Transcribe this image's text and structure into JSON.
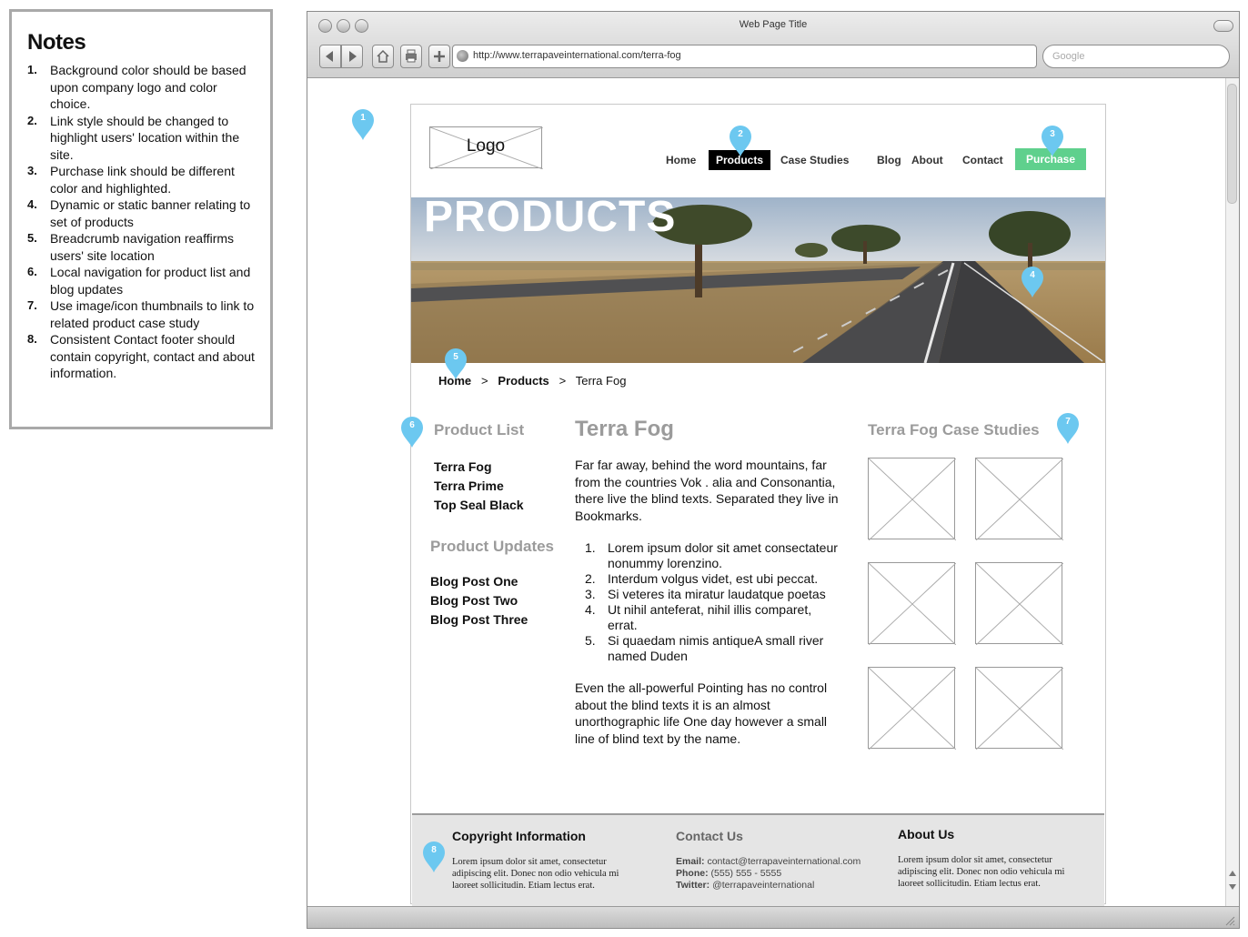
{
  "notes": {
    "title": "Notes",
    "items": [
      {
        "num": "1.",
        "text": "Background color should be based upon company logo and color choice."
      },
      {
        "num": "2.",
        "text": "Link style should be changed to highlight users' location within the site."
      },
      {
        "num": "3.",
        "text": "Purchase link should be different color and highlighted."
      },
      {
        "num": "4.",
        "text": "Dynamic or static banner relating to set of products"
      },
      {
        "num": "5.",
        "text": "Breadcrumb navigation reaffirms users' site location"
      },
      {
        "num": "6.",
        "text": "Local navigation for product list and blog updates"
      },
      {
        "num": "7.",
        "text": "Use image/icon thumbnails to link to related product case study"
      },
      {
        "num": "8.",
        "text": "Consistent Contact footer should contain copyright, contact and about information."
      }
    ]
  },
  "browser": {
    "window_title": "Web Page Title",
    "url": "http://www.terrapaveinternational.com/terra-fog",
    "search_placeholder": "Google",
    "toolbar_icons": [
      "back-icon",
      "forward-icon",
      "home-icon",
      "print-icon",
      "add-bookmark-icon"
    ]
  },
  "site": {
    "logo_label": "Logo",
    "nav": [
      "Home",
      "Products",
      "Case Studies",
      "Blog",
      "About",
      "Contact",
      "Purchase"
    ],
    "nav_active": "Products",
    "banner_title": "PRODUCTS",
    "breadcrumb": {
      "home": "Home",
      "products": "Products",
      "current": "Terra Fog",
      "separator": ">"
    },
    "sidebar": {
      "product_list_title": "Product List",
      "products": [
        "Terra Fog",
        "Terra Prime",
        "Top Seal Black"
      ],
      "updates_title": "Product Updates",
      "posts": [
        "Blog Post One",
        "Blog Post Two",
        "Blog Post Three"
      ]
    },
    "main": {
      "title": "Terra Fog",
      "intro": "Far far away, behind the word mountains, far from the countries Vok . alia and Consonantia, there live the blind texts. Separated they live in Bookmarks.",
      "list": [
        {
          "n": "1.",
          "text": "Lorem ipsum dolor sit amet consectateur nonummy lorenzino."
        },
        {
          "n": "2.",
          "text": "Interdum volgus videt, est ubi peccat."
        },
        {
          "n": "3.",
          "text": "Si veteres ita miratur laudatque poetas"
        },
        {
          "n": "4.",
          "text": "Ut nihil anteferat, nihil illis comparet, errat."
        },
        {
          "n": "5.",
          "text": "Si quaedam nimis antiqueA small river named Duden"
        }
      ],
      "outro": "Even the all-powerful Pointing has no control about the blind texts it is an almost unorthographic life One day however a small line of blind text by the name."
    },
    "case_studies_title": "Terra Fog Case Studies",
    "footer": {
      "copyright_title": "Copyright Information",
      "copyright_text": "Lorem ipsum dolor sit amet, consectetur adipiscing elit. Donec non odio vehicula mi laoreet sollicitudin. Etiam lectus erat.",
      "contact_title": "Contact Us",
      "email_label": "Email:",
      "email": "contact@terrapaveinternational.com",
      "phone_label": "Phone:",
      "phone": "(555) 555 - 5555",
      "twitter_label": "Twitter:",
      "twitter": "@terrapaveinternational",
      "about_title": "About Us",
      "about_text": "Lorem ipsum dolor sit amet, consectetur adipiscing elit. Donec non odio vehicula mi laoreet sollicitudin. Etiam lectus erat."
    }
  },
  "markers": [
    "1",
    "2",
    "3",
    "4",
    "5",
    "6",
    "7",
    "8"
  ],
  "colors": {
    "marker": "#6cc8f0",
    "purchase": "#5fd08d",
    "active_nav": "#000000",
    "heading_gray": "#9b9b9b",
    "footer_bg": "#e5e5e5"
  }
}
